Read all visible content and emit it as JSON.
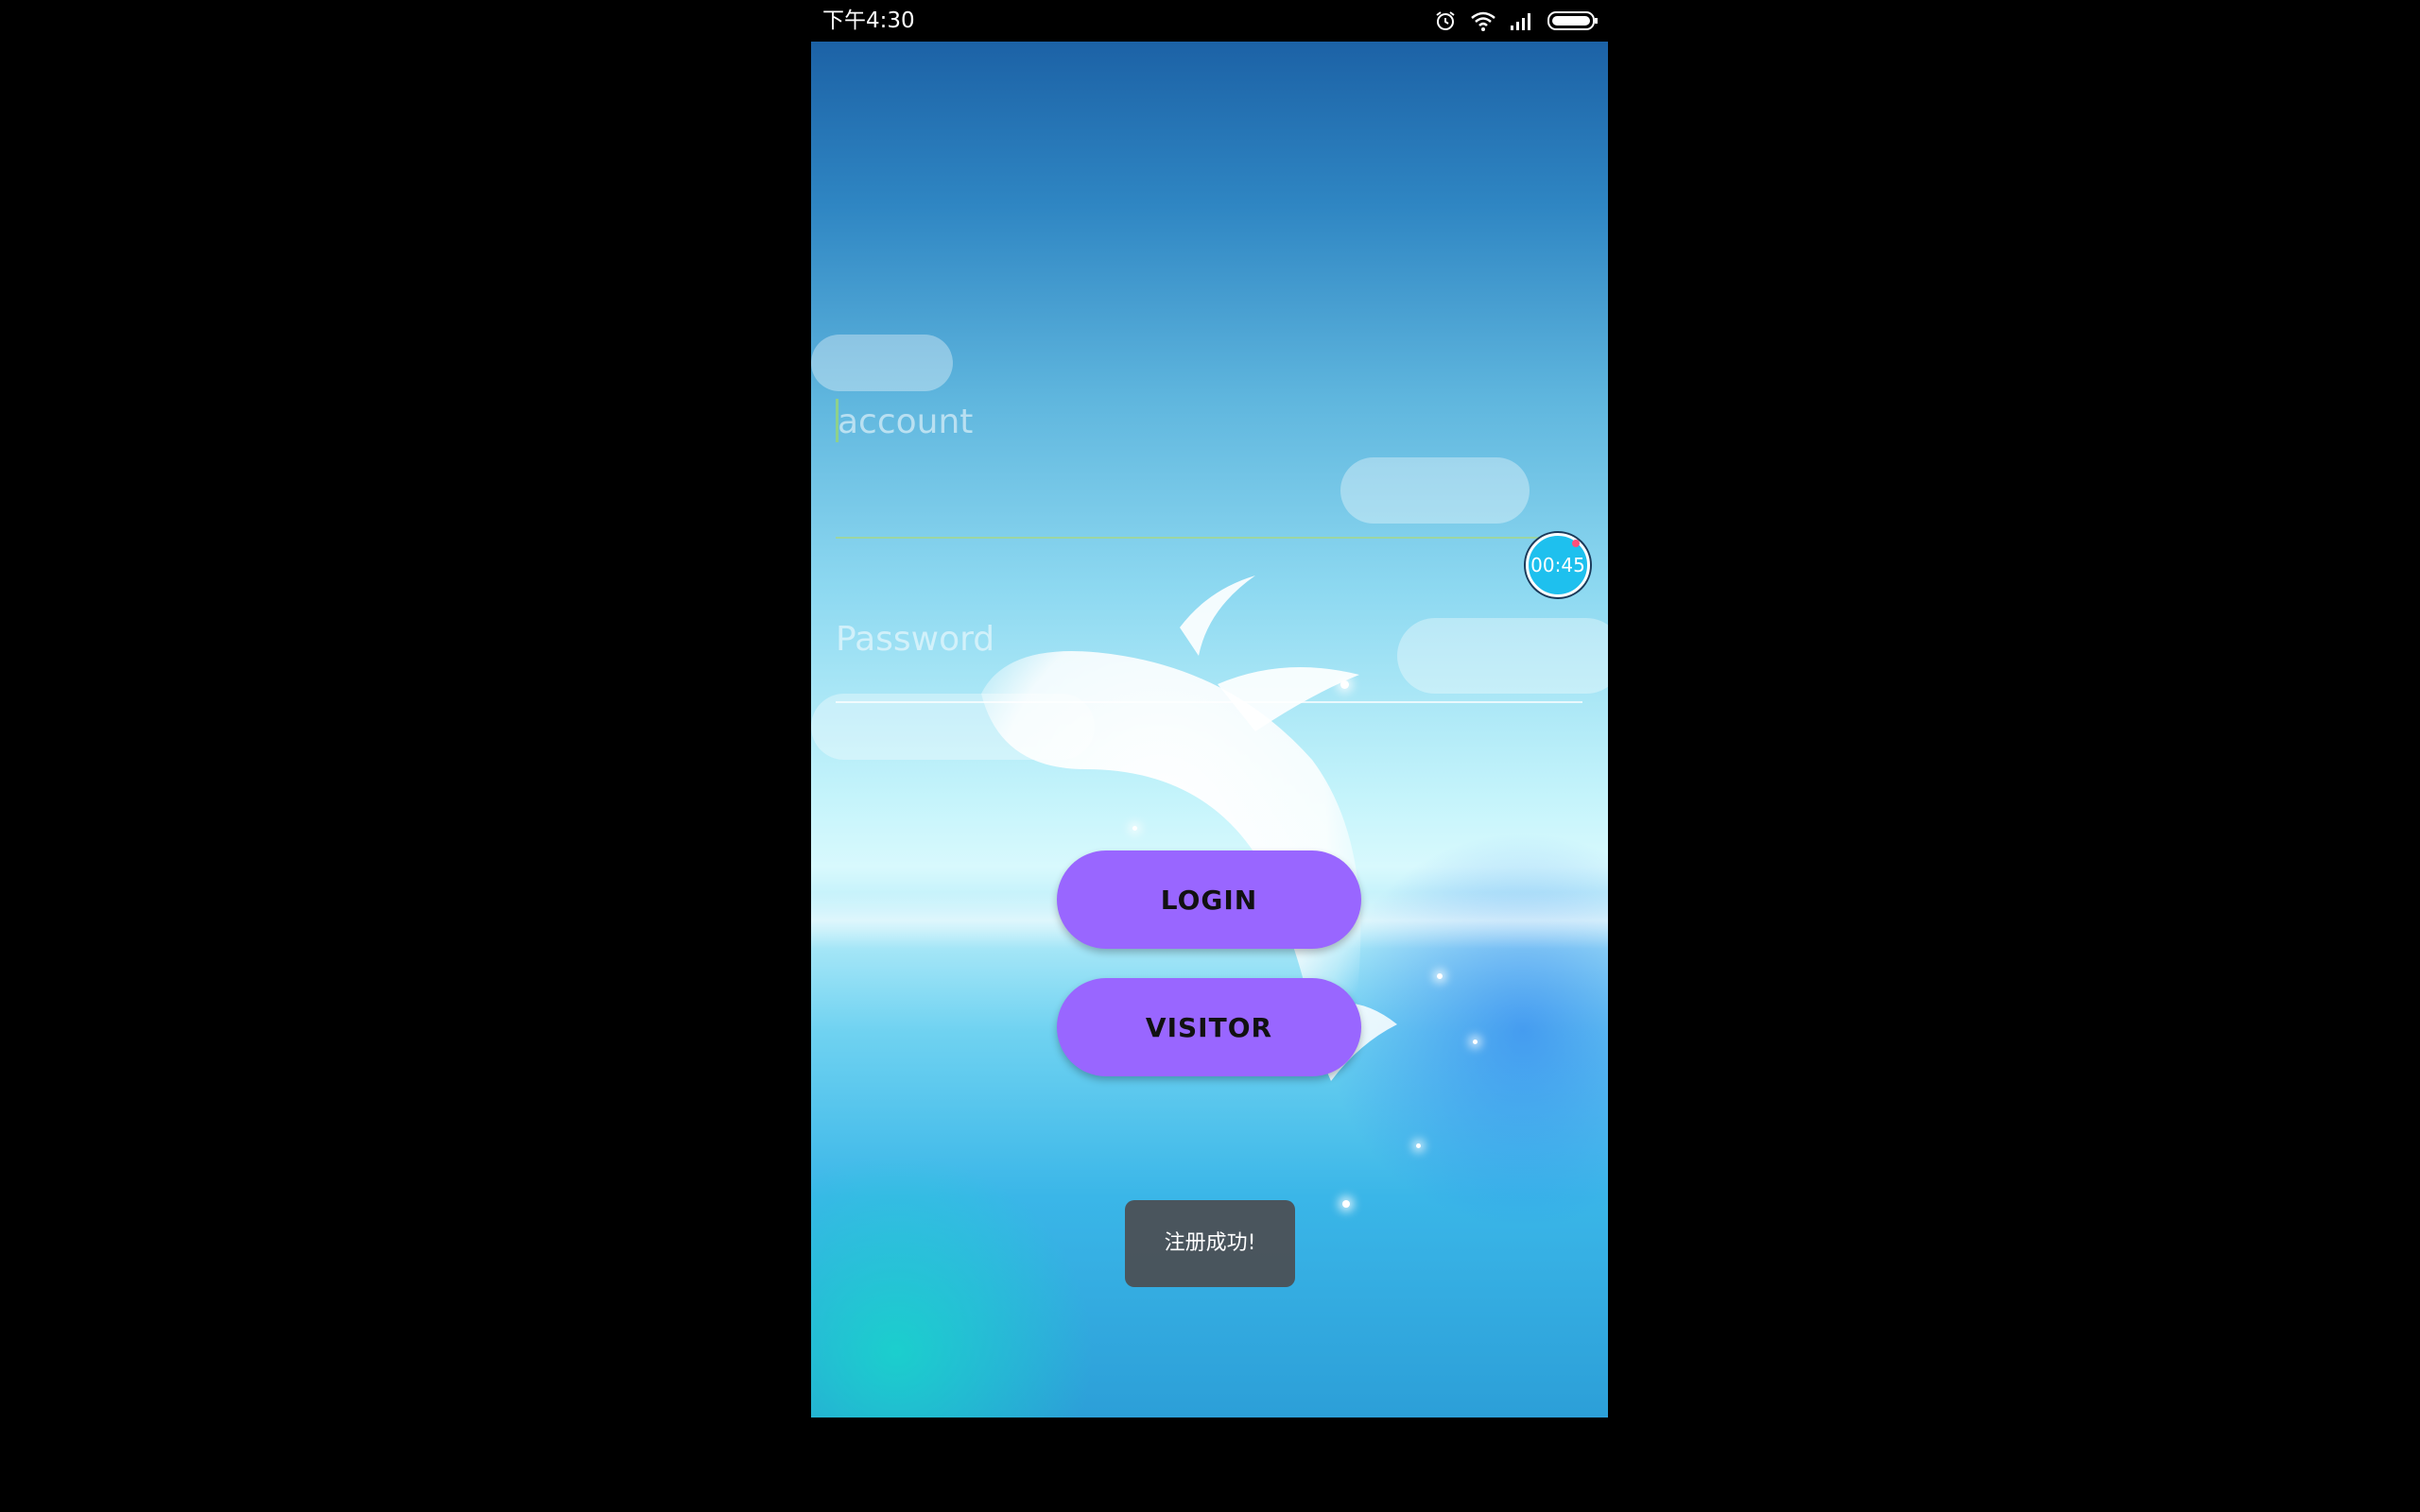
{
  "status_bar": {
    "time": "下午4:30",
    "icons": [
      "alarm-icon",
      "wifi-icon",
      "signal-icon",
      "battery-icon"
    ]
  },
  "login_form": {
    "account_placeholder": "account",
    "password_placeholder": "Password",
    "login_label": "LOGIN",
    "visitor_label": "VISITOR"
  },
  "timer_overlay": {
    "text": "00:45"
  },
  "toast": {
    "message": "注册成功!"
  },
  "colors": {
    "button": "#9966ff",
    "toast": "#4b5055",
    "timer": "#1ec0ee"
  }
}
